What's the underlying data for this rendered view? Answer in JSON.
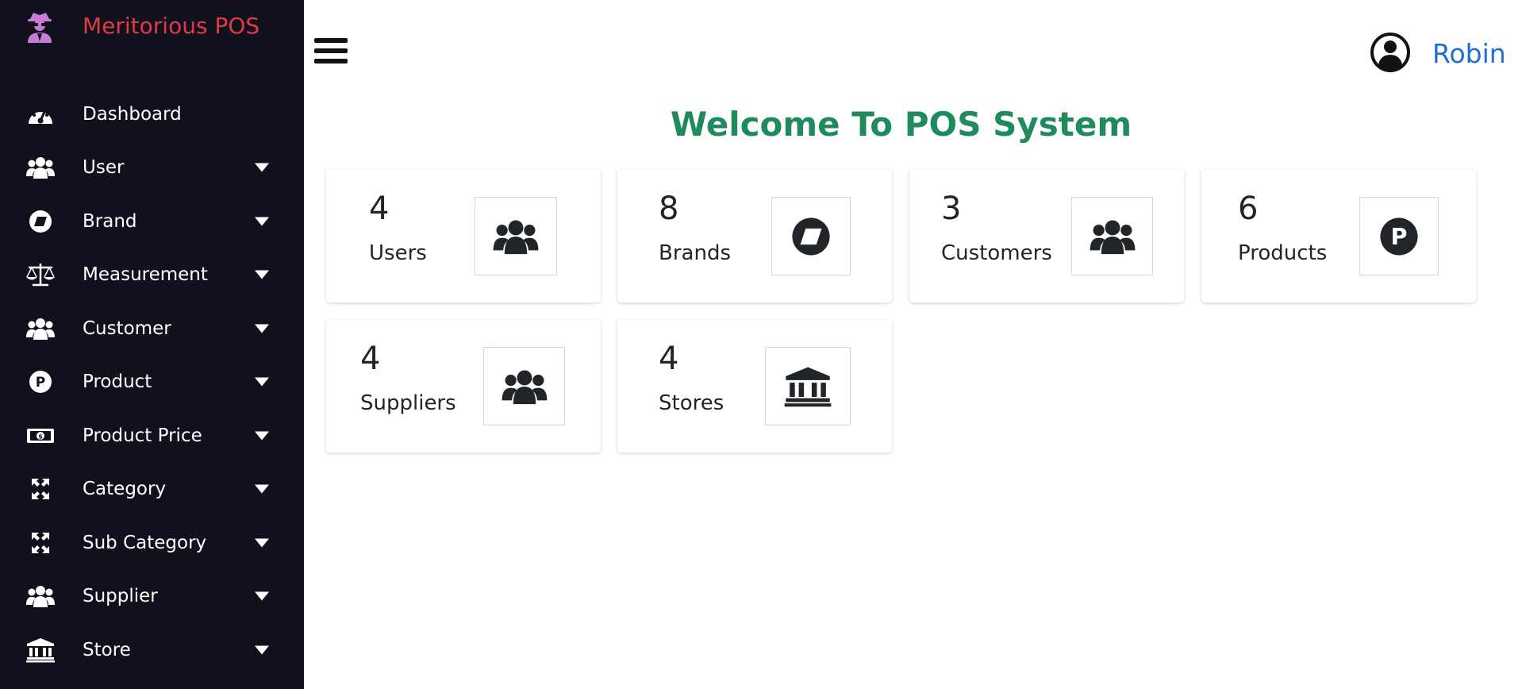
{
  "app": {
    "title": "Meritorious POS"
  },
  "sidebar": {
    "items": [
      {
        "label": "Dashboard",
        "icon": "gauge-icon",
        "has_dropdown": false
      },
      {
        "label": "User",
        "icon": "users-icon",
        "has_dropdown": true
      },
      {
        "label": "Brand",
        "icon": "brand-icon",
        "has_dropdown": true
      },
      {
        "label": "Measurement",
        "icon": "scale-icon",
        "has_dropdown": true
      },
      {
        "label": "Customer",
        "icon": "users-icon",
        "has_dropdown": true
      },
      {
        "label": "Product",
        "icon": "product-p-icon",
        "has_dropdown": true
      },
      {
        "label": "Product Price",
        "icon": "money-icon",
        "has_dropdown": true
      },
      {
        "label": "Category",
        "icon": "expand-arrows-icon",
        "has_dropdown": true
      },
      {
        "label": "Sub Category",
        "icon": "expand-arrows-icon",
        "has_dropdown": true
      },
      {
        "label": "Supplier",
        "icon": "users-icon",
        "has_dropdown": true
      },
      {
        "label": "Store",
        "icon": "bank-icon",
        "has_dropdown": true
      }
    ]
  },
  "header": {
    "user_name": "Robin"
  },
  "main": {
    "welcome": "Welcome To POS System",
    "cards": [
      {
        "count": "4",
        "label": "Users",
        "icon": "users-icon"
      },
      {
        "count": "8",
        "label": "Brands",
        "icon": "brand-icon"
      },
      {
        "count": "3",
        "label": "Customers",
        "icon": "users-icon"
      },
      {
        "count": "6",
        "label": "Products",
        "icon": "product-p-icon"
      },
      {
        "count": "4",
        "label": "Suppliers",
        "icon": "users-icon"
      },
      {
        "count": "4",
        "label": "Stores",
        "icon": "bank-icon"
      }
    ]
  },
  "colors": {
    "sidebar_bg": "#11111e",
    "brand_title": "#e0394a",
    "welcome_text": "#1f8a5c",
    "user_link": "#1f6fd1"
  }
}
